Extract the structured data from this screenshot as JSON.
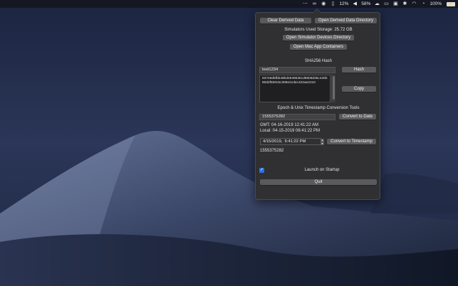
{
  "menubar": {
    "cpu": "12%",
    "battery_pct": "58%",
    "battery_main": "100%"
  },
  "panel": {
    "clear_derived_data": "Clear Derived Data",
    "open_derived_data_dir": "Open Derived Data Directory",
    "simulators_storage": "Simulators Used Storage: 25.72 GB",
    "open_sim_devices_dir": "Open Simulator Devices Directory",
    "open_mac_app_containers": "Open Mac App Containers",
    "sha_title": "SHA256 Hash",
    "hash_input_value": "test1234",
    "hash_button": "Hash",
    "hash_output": "937e8d5fbb48bd4949536cd65b8d35c426b80d2f830c5c308e2cdec422ae2244",
    "copy_button": "Copy",
    "epoch_title": "Epoch & Unix Timestamp Conversion Tools",
    "epoch_input_value": "1555375282",
    "convert_to_date": "Convert to Date",
    "gmt_line": "GMT: 04-16-2019 12:41:22 AM",
    "local_line": "Local: 04-15-2019 06:41:22 PM",
    "date_picker_value": "4/15/2019,  6:41:22 PM",
    "convert_to_timestamp": "Convert to Timestamp",
    "timestamp_result": "1555375282",
    "launch_on_startup": "Launch on Startup",
    "launch_on_startup_checked": true,
    "quit_button": "Quit"
  },
  "colors": {
    "panel_bg": "#303032",
    "button_bg": "#5a5a5d",
    "checkbox_accent": "#2f6fe0"
  }
}
